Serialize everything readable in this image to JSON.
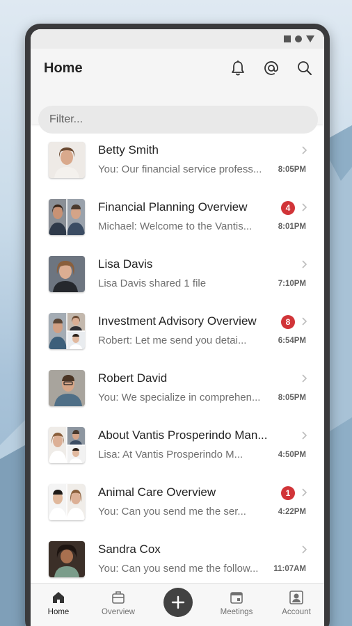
{
  "header": {
    "title": "Home",
    "filter_placeholder": "Filter..."
  },
  "icons": {
    "notifications": "bell-icon",
    "mentions": "at-icon",
    "search": "search-icon"
  },
  "chats": [
    {
      "title": "Betty Smith",
      "preview": "You: Our financial service profess...",
      "time": "8:05PM",
      "unread": null
    },
    {
      "title": "Financial Planning Overview",
      "preview": "Michael:  Welcome to the Vantis...",
      "time": "8:01PM",
      "unread": "4"
    },
    {
      "title": "Lisa Davis",
      "preview": "Lisa Davis shared 1 file",
      "time": "7:10PM",
      "unread": null
    },
    {
      "title": "Investment Advisory Overview",
      "preview": "Robert:  Let me send you detai...",
      "time": "6:54PM",
      "unread": "8"
    },
    {
      "title": "Robert David",
      "preview": "You: We specialize in comprehen...",
      "time": "8:05PM",
      "unread": null
    },
    {
      "title": "About Vantis Prosperindo Man...",
      "preview": "Lisa:  At Vantis Prosperindo M...",
      "time": "4:50PM",
      "unread": null
    },
    {
      "title": "Animal Care Overview",
      "preview": "You:  Can you send me the ser...",
      "time": "4:22PM",
      "unread": "1"
    },
    {
      "title": "Sandra Cox",
      "preview": "You: Can you send me the follow...",
      "time": "11:07AM",
      "unread": null
    }
  ],
  "nav": {
    "home": "Home",
    "overview": "Overview",
    "meetings": "Meetings",
    "account": "Account"
  },
  "colors": {
    "badge": "#d13438",
    "fab": "#424242"
  }
}
